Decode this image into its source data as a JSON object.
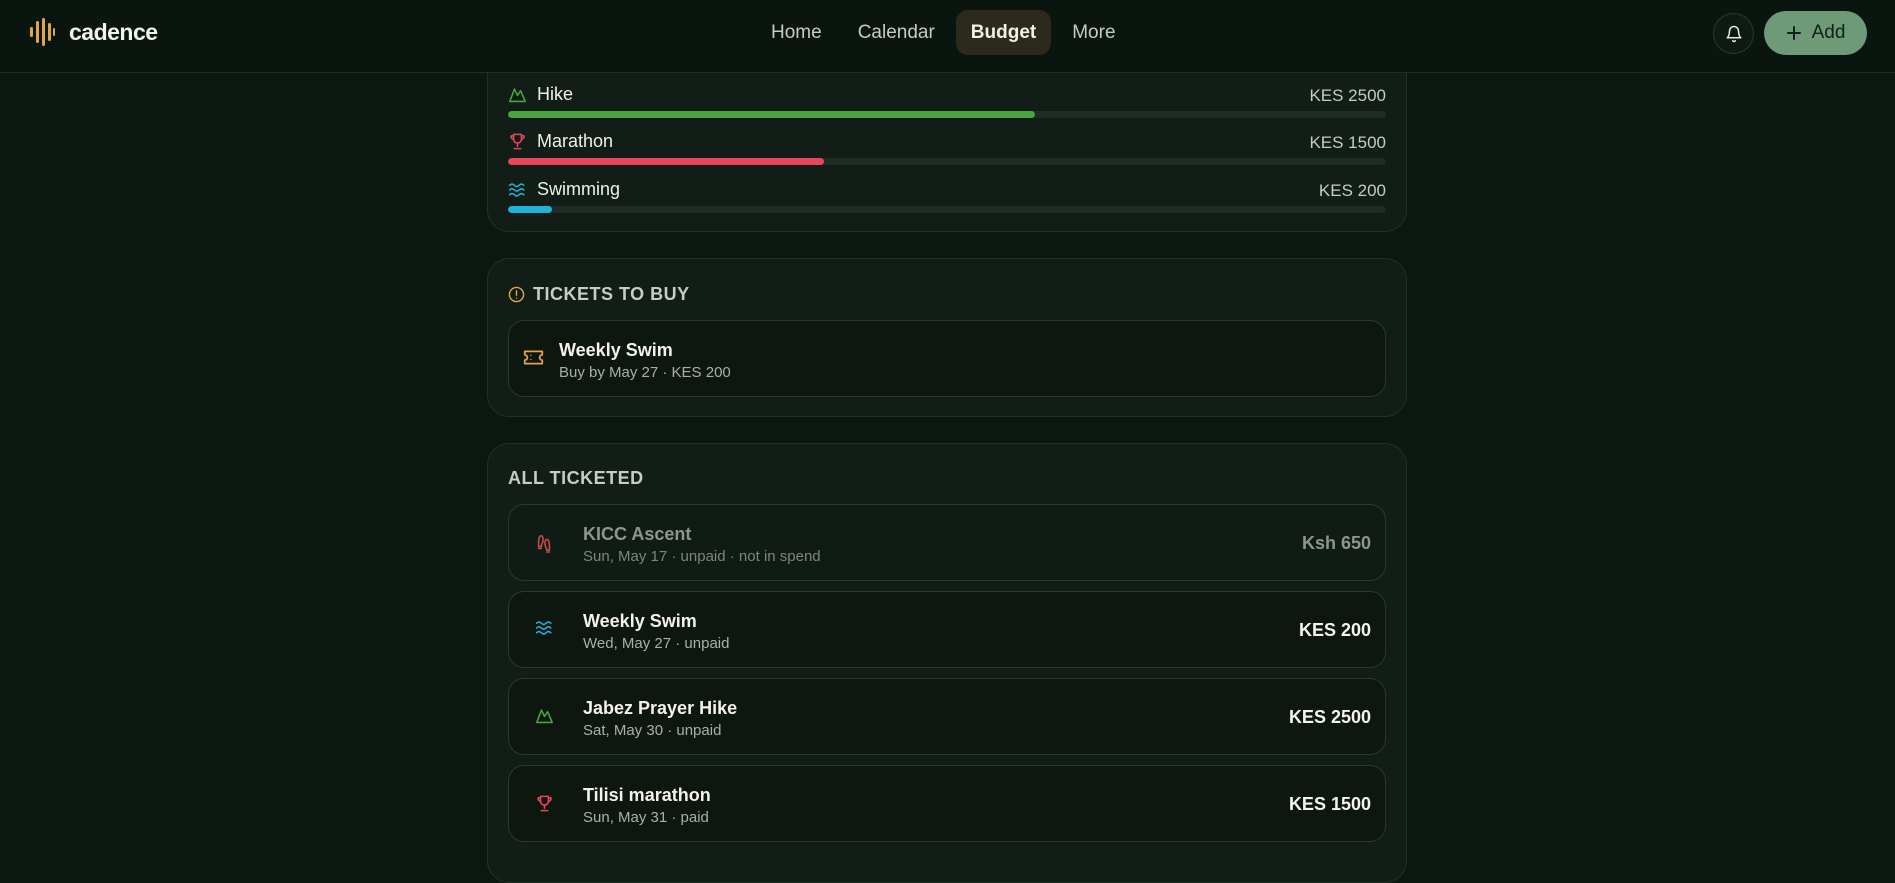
{
  "app": {
    "name": "cadence"
  },
  "nav": {
    "items": [
      {
        "label": "Home"
      },
      {
        "label": "Calendar"
      },
      {
        "label": "Budget",
        "active": true
      },
      {
        "label": "More"
      }
    ],
    "add_label": "Add"
  },
  "spend": {
    "rows": [
      {
        "label": "Hike",
        "amount": "KES 2500",
        "fraction": 0.6,
        "color": "#4aa43f",
        "icon": "mountain-icon"
      },
      {
        "label": "Marathon",
        "amount": "KES 1500",
        "fraction": 0.36,
        "color": "#e8455f",
        "icon": "trophy-icon"
      },
      {
        "label": "Swimming",
        "amount": "KES 200",
        "fraction": 0.05,
        "color": "#1fb3d9",
        "icon": "waves-icon"
      }
    ]
  },
  "tickets_to_buy": {
    "title": "TICKETS TO BUY",
    "accent": "#e0a64a",
    "items": [
      {
        "title": "Weekly Swim",
        "subtitle": "Buy by May 27 · KES 200",
        "icon": "ticket-icon"
      }
    ]
  },
  "all_ticketed": {
    "title": "ALL TICKETED",
    "items": [
      {
        "title": "KICC Ascent",
        "subtitle": "Sun, May 17 · unpaid · not in spend",
        "amount": "Ksh 650",
        "icon": "footprints-icon",
        "dimmed": true
      },
      {
        "title": "Weekly Swim",
        "subtitle": "Wed, May 27 · unpaid",
        "amount": "KES 200",
        "icon": "waves-icon"
      },
      {
        "title": "Jabez Prayer Hike",
        "subtitle": "Sat, May 30 · unpaid",
        "amount": "KES 2500",
        "icon": "mountain-icon"
      },
      {
        "title": "Tilisi marathon",
        "subtitle": "Sun, May 31 · paid",
        "amount": "KES 1500",
        "icon": "trophy-icon"
      }
    ]
  }
}
